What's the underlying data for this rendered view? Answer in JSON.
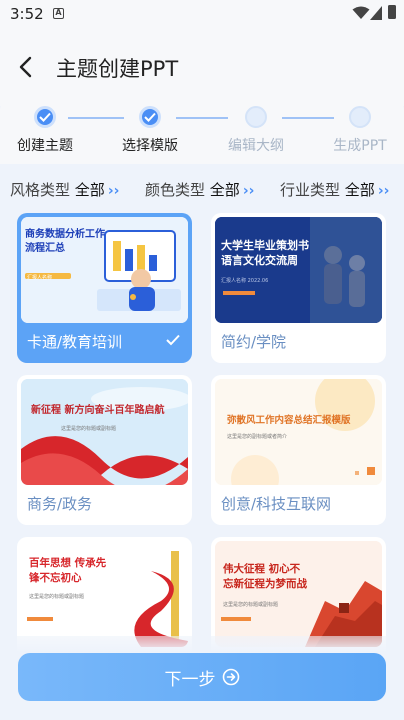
{
  "status_bar": {
    "time": "3:52",
    "notification_icon": "A"
  },
  "header": {
    "title": "主题创建PPT"
  },
  "steps": [
    {
      "label": "创建主题",
      "state": "done"
    },
    {
      "label": "选择模版",
      "state": "done"
    },
    {
      "label": "编辑大纲",
      "state": "todo"
    },
    {
      "label": "生成PPT",
      "state": "todo"
    }
  ],
  "filters": [
    {
      "label": "风格类型",
      "value": "全部",
      "chevron": "››"
    },
    {
      "label": "颜色类型",
      "value": "全部",
      "chevron": "››"
    },
    {
      "label": "行业类型",
      "value": "全部",
      "chevron": "››"
    }
  ],
  "templates": [
    {
      "name": "卡通/教育培训",
      "selected": true,
      "thumb_title_1": "商务数据分析工作",
      "thumb_title_2": "流程汇总",
      "thumb_sub": "汇报人名称"
    },
    {
      "name": "简约/学院",
      "selected": false,
      "thumb_title_1": "大学生毕业策划书",
      "thumb_title_2": "语言文化交流周",
      "thumb_sub": "汇报人名称 2022.06"
    },
    {
      "name": "商务/政务",
      "selected": false,
      "thumb_title_1": "新征程 新方向奋斗百年路启航",
      "thumb_sub": "这里是您的标题或副标题"
    },
    {
      "name": "创意/科技互联网",
      "selected": false,
      "thumb_title_1": "弥散风工作内容总结汇报模版",
      "thumb_sub": "这里是您的副标题或者简介"
    },
    {
      "name": "",
      "selected": false,
      "thumb_title_1": "百年思想 传承先",
      "thumb_title_2": "锋不忘初心",
      "thumb_sub": "这里是您的标题或副标题"
    },
    {
      "name": "",
      "selected": false,
      "thumb_title_1": "伟大征程 初心不",
      "thumb_title_2": "忘新征程为梦而战",
      "thumb_sub": "这里是您的标题或副标题"
    }
  ],
  "next_button": {
    "label": "下一步"
  },
  "colors": {
    "accent": "#4a8ef5",
    "selected_card": "#5ca3f6",
    "button": "#5aa5f5",
    "background": "#eef3fb"
  }
}
